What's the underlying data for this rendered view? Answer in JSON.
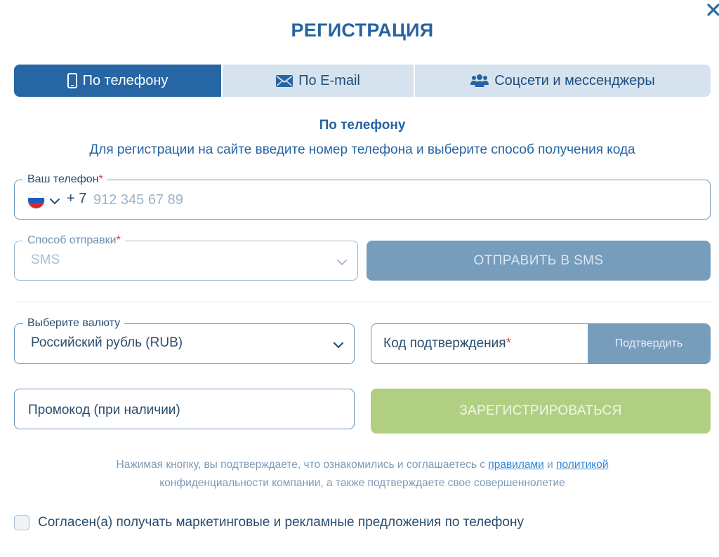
{
  "modal": {
    "title": "РЕГИСТРАЦИЯ",
    "close_icon": "close-icon"
  },
  "tabs": [
    {
      "label": "По телефону",
      "icon": "phone-icon",
      "active": true
    },
    {
      "label": "По E-mail",
      "icon": "envelope-icon",
      "active": false
    },
    {
      "label": "Соцсети и мессенджеры",
      "icon": "users-icon",
      "active": false
    }
  ],
  "section": {
    "title": "По телефону",
    "description": "Для регистрации на сайте введите номер телефона и выберите способ получения кода"
  },
  "phone": {
    "label": "Ваш телефон",
    "required_mark": "*",
    "country_flag": "russia-flag-icon",
    "code": "+ 7",
    "placeholder": "912 345 67 89",
    "value": ""
  },
  "send_method": {
    "label": "Способ отправки",
    "required_mark": "*",
    "value": "SMS"
  },
  "send_button": {
    "label": "ОТПРАВИТЬ В SMS"
  },
  "currency": {
    "label": "Выберите валюту",
    "value": "Российский рубль (RUB)"
  },
  "confirmation": {
    "label": "Код подтверждения",
    "required_mark": "*",
    "button_label": "Подтвердить"
  },
  "promo": {
    "placeholder": "Промокод (при наличии)"
  },
  "register_button": {
    "label": "ЗАРЕГИСТРИРОВАТЬСЯ"
  },
  "legal": {
    "text_before": "Нажимая кнопку, вы подтверждаете, что ознакомились и соглашаетесь с ",
    "rules_link": "правилами",
    "and": " и ",
    "policy_link": "политикой",
    "text_after": "конфиденциальности компании, а также подтверждаете свое совершеннолетие"
  },
  "marketing": {
    "label": "Согласен(а) получать маркетинговые и рекламные предложения по телефону",
    "checked": false
  },
  "colors": {
    "primary": "#2766a5",
    "tab_inactive": "#d6e3ee",
    "button_disabled": "#779dbd",
    "register_disabled": "#b1cf83",
    "required": "#e23b3b",
    "link": "#2e86d6"
  }
}
